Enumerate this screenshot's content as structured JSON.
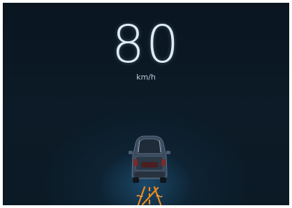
{
  "display": {
    "speed_value": "80",
    "speed_unit": "km/h"
  },
  "icons": {
    "vehicle": "car-rear-icon",
    "warning": "hazard-lights-icon"
  },
  "colors": {
    "background": "#0b1a25",
    "glow": "#286ea0",
    "speed_text": "#dfeaf2",
    "warning": "#f08a1c"
  }
}
